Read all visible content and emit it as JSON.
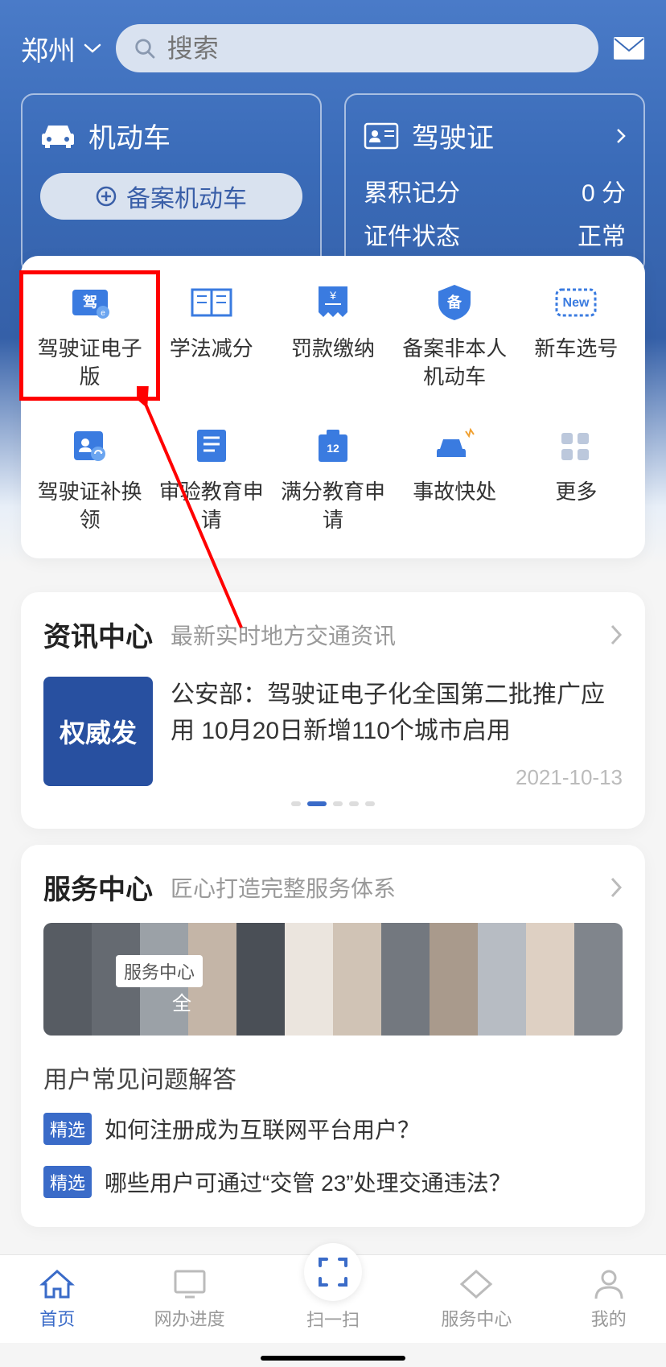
{
  "header": {
    "location": "郑州",
    "search_placeholder": "搜索"
  },
  "cards": {
    "vehicle": {
      "title": "机动车",
      "button_label": "备案机动车"
    },
    "license": {
      "title": "驾驶证",
      "points_label": "累积记分",
      "points_value": "0 分",
      "status_label": "证件状态",
      "status_value": "正常"
    }
  },
  "services": [
    {
      "label": "驾驶证电子版",
      "highlighted": true
    },
    {
      "label": "学法减分"
    },
    {
      "label": "罚款缴纳"
    },
    {
      "label": "备案非本人机动车"
    },
    {
      "label": "新车选号"
    },
    {
      "label": "驾驶证补换领"
    },
    {
      "label": "审验教育申请"
    },
    {
      "label": "满分教育申请"
    },
    {
      "label": "事故快处"
    },
    {
      "label": "更多"
    }
  ],
  "news_section": {
    "title": "资讯中心",
    "subtitle": "最新实时地方交通资讯",
    "item": {
      "thumb_text": "权威发",
      "headline": "公安部：驾驶证电子化全国第二批推广应用 10月20日新增110个城市启用",
      "date": "2021-10-13"
    }
  },
  "service_section": {
    "title": "服务中心",
    "subtitle": "匠心打造完整服务体系",
    "banner_tag": "服务中心",
    "banner_text": "全",
    "faq_title": "用户常见问题解答",
    "faq_tag": "精选",
    "faqs": [
      "如何注册成为互联网平台用户？",
      "哪些用户可通过“交管    23”处理交通违法？"
    ]
  },
  "nav": [
    {
      "label": "首页",
      "active": true
    },
    {
      "label": "网办进度"
    },
    {
      "label": "扫一扫"
    },
    {
      "label": "服务中心"
    },
    {
      "label": "我的"
    }
  ]
}
